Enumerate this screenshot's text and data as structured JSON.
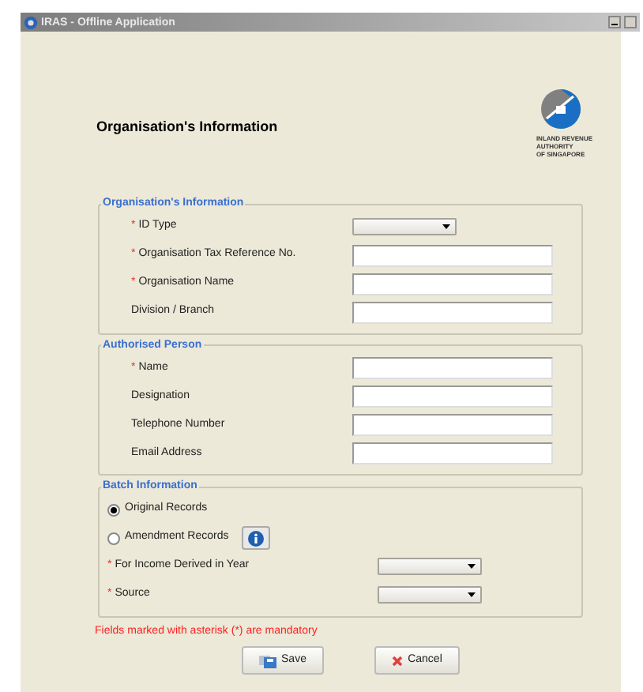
{
  "window": {
    "title": "IRAS - Offline Application"
  },
  "heading": "Organisation's Information",
  "logo": {
    "lines": [
      "INLAND REVENUE",
      "AUTHORITY",
      "OF SINGAPORE"
    ]
  },
  "sections": [
    {
      "legend": "Organisation's Information",
      "rows": [
        {
          "kind": "dropdown",
          "label": "ID Type",
          "required_mark": "*"
        },
        {
          "kind": "text",
          "label": "Organisation Tax Reference No.",
          "required_mark": "*"
        },
        {
          "kind": "text",
          "label": "Organisation Name",
          "required_mark": "*"
        },
        {
          "kind": "text",
          "label": "Division / Branch"
        }
      ]
    },
    {
      "legend": "Authorised Person",
      "rows": [
        {
          "kind": "text",
          "label": "Name",
          "required_mark": "*"
        },
        {
          "kind": "text",
          "label": "Designation"
        },
        {
          "kind": "text",
          "label": "Telephone Number"
        },
        {
          "kind": "text",
          "label": "Email Address"
        }
      ]
    },
    {
      "legend": "Batch Information",
      "rows": [
        {
          "kind": "radio",
          "label": "Original Records",
          "selected": true
        },
        {
          "kind": "radio",
          "label": "Amendment Records",
          "selected": false,
          "info_button": true
        },
        {
          "kind": "dropdown_wide",
          "label": "For Income Derived in Year",
          "required_mark": "*"
        },
        {
          "kind": "dropdown_wide",
          "label": "Source",
          "required_mark": "*"
        }
      ]
    }
  ],
  "note": "Fields marked with asterisk (*) are mandatory",
  "buttons": [
    {
      "kind": "save",
      "label": "Save"
    },
    {
      "kind": "cancel",
      "label": "Cancel"
    }
  ]
}
